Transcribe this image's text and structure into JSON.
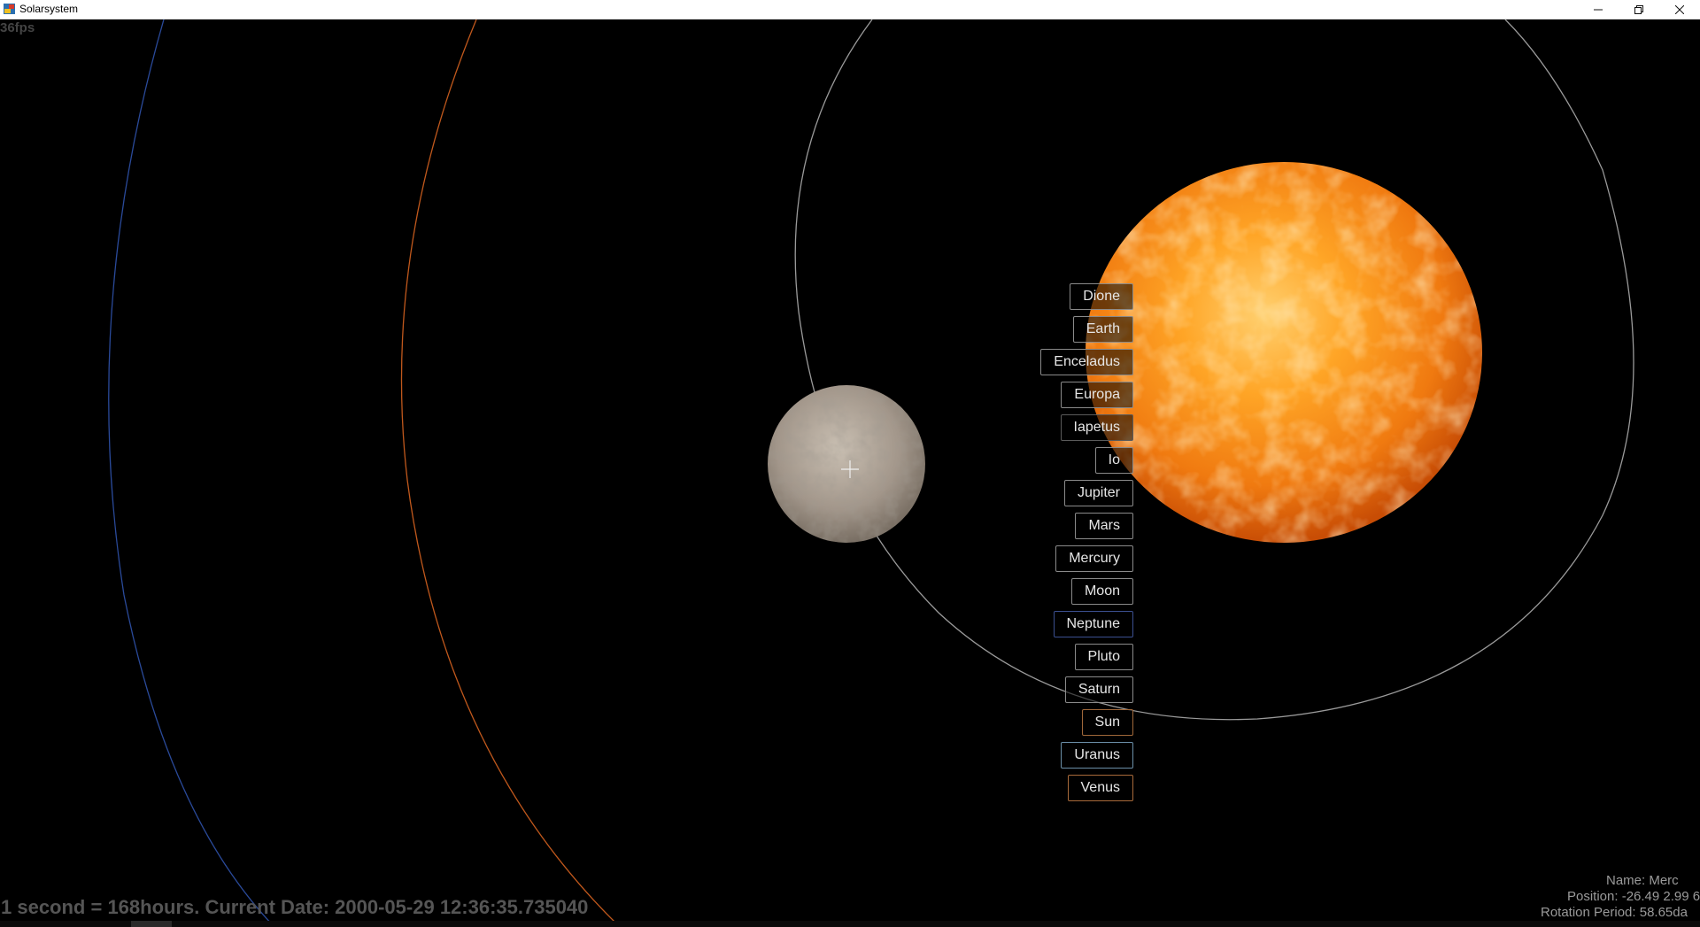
{
  "window": {
    "title": "Solarsystem",
    "minimize_glyph": "—",
    "maximize_glyph": "❒",
    "close_glyph": "✕"
  },
  "hud": {
    "fps": "36fps",
    "status": "1 second = 168hours. Current Date: 2000-05-29 12:36:35.735040"
  },
  "planets": [
    {
      "label": "Dione",
      "border": "#8a8a8a"
    },
    {
      "label": "Earth",
      "border": "#8a8a8a"
    },
    {
      "label": "Enceladus",
      "border": "#8a8a8a"
    },
    {
      "label": "Europa",
      "border": "#8a8a8a"
    },
    {
      "label": "Iapetus",
      "border": "#5a5a5a"
    },
    {
      "label": "Io",
      "border": "#8a8a8a"
    },
    {
      "label": "Jupiter",
      "border": "#8a8a8a"
    },
    {
      "label": "Mars",
      "border": "#8a8a8a"
    },
    {
      "label": "Mercury",
      "border": "#8a8a8a"
    },
    {
      "label": "Moon",
      "border": "#8a8a8a"
    },
    {
      "label": "Neptune",
      "border": "#3b4f8f"
    },
    {
      "label": "Pluto",
      "border": "#8a8a8a"
    },
    {
      "label": "Saturn",
      "border": "#8a8a8a"
    },
    {
      "label": "Sun",
      "border": "#a0683a"
    },
    {
      "label": "Uranus",
      "border": "#6b8fa8"
    },
    {
      "label": "Venus",
      "border": "#a86a3a"
    }
  ],
  "info": {
    "name": "Name: Merc",
    "position": "Position: -26.49 2.99 6",
    "rotation": "Rotation Period: 58.65da"
  },
  "colors": {
    "orbit_blue": "#2a4a9a",
    "orbit_orange": "#c0581c",
    "orbit_gray": "#9a9a9a",
    "sun_core": "#ffb030",
    "sun_edge": "#d85a08",
    "mercury": "#a89a8a"
  }
}
